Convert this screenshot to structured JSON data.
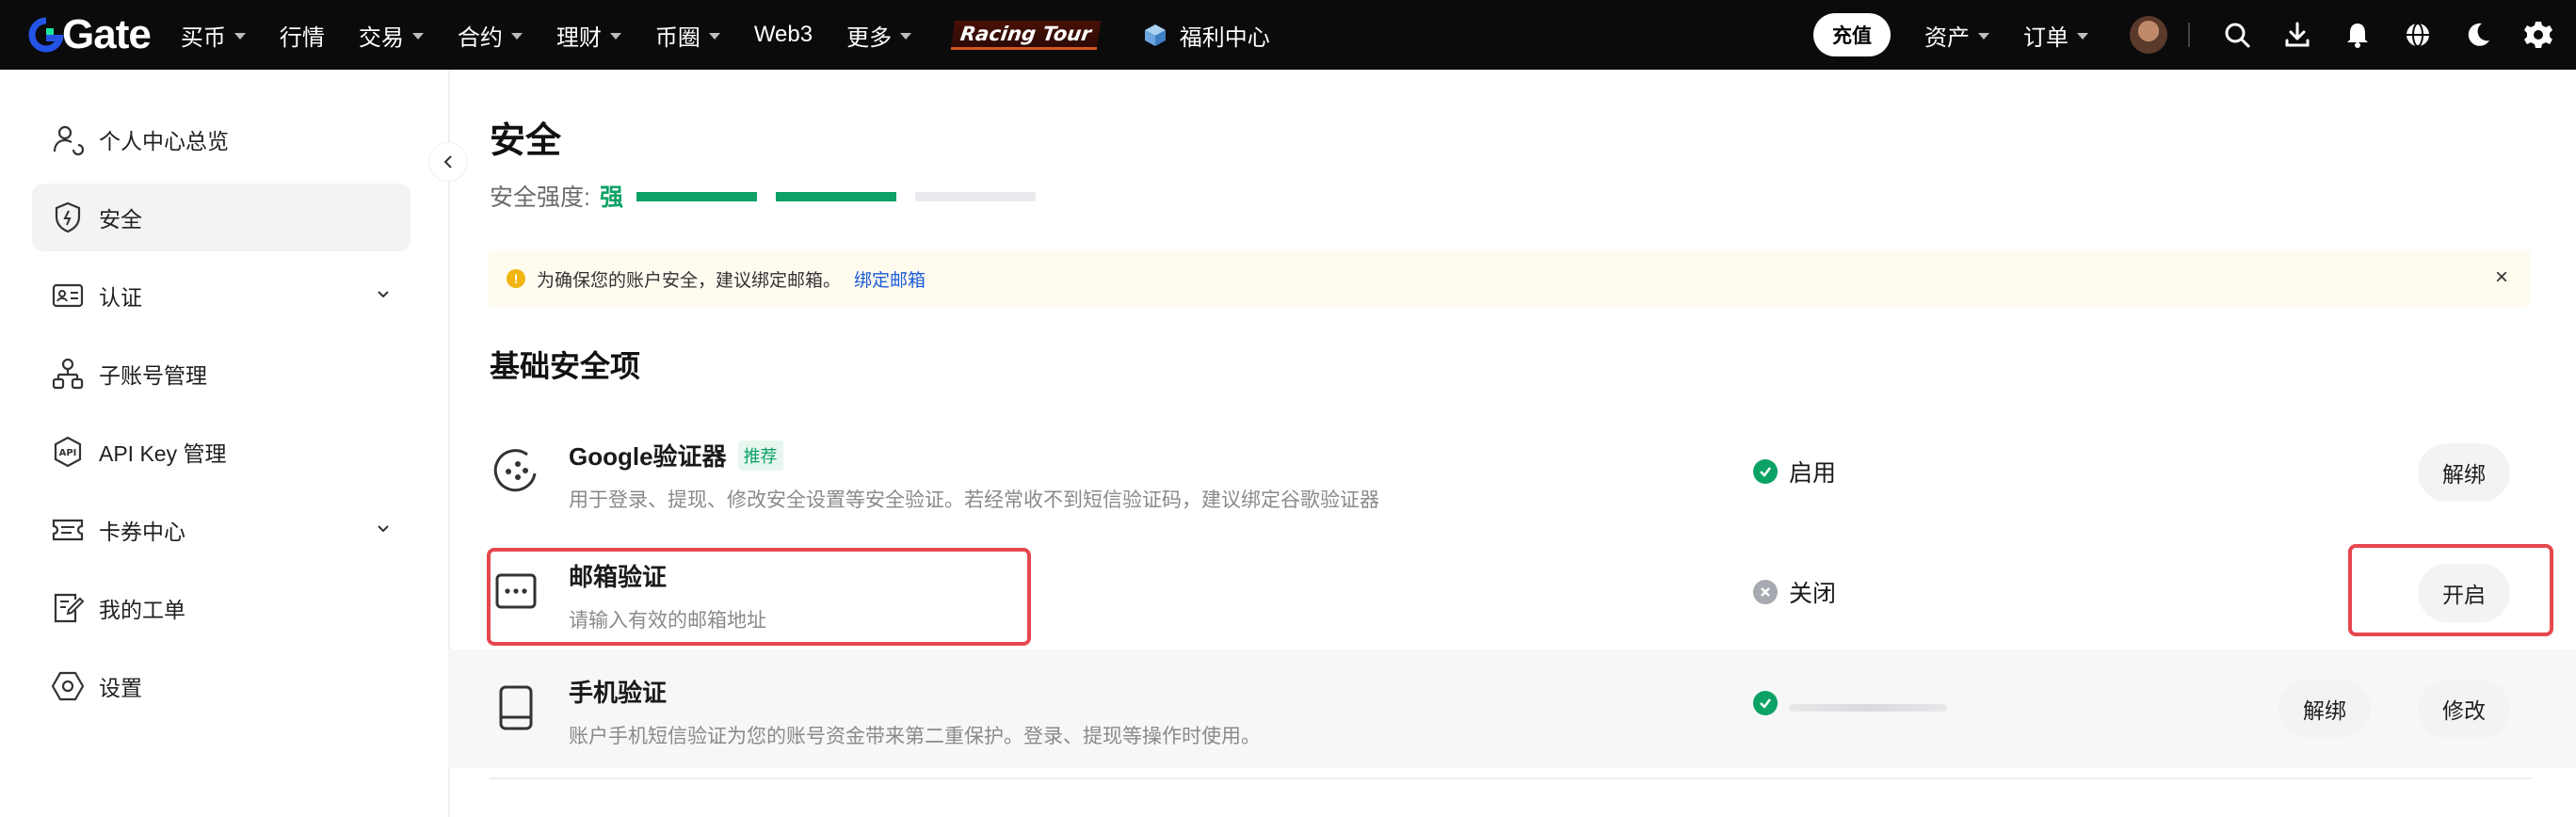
{
  "nav": {
    "logo": "Gate",
    "items": [
      {
        "label": "买币",
        "caret": true
      },
      {
        "label": "行情",
        "caret": false
      },
      {
        "label": "交易",
        "caret": true
      },
      {
        "label": "合约",
        "caret": true
      },
      {
        "label": "理财",
        "caret": true
      },
      {
        "label": "币圈",
        "caret": true
      },
      {
        "label": "Web3",
        "caret": false
      },
      {
        "label": "更多",
        "caret": true
      }
    ],
    "racing": "Racing Tour",
    "gift_label": "福利中心",
    "deposit": "充值",
    "assets": "资产",
    "orders": "订单",
    "icons": [
      "search-icon",
      "download-icon",
      "bell-icon",
      "globe-icon",
      "moon-icon",
      "gear-icon"
    ]
  },
  "sidebar": {
    "items": [
      {
        "label": "个人中心总览",
        "icon": "user-icon",
        "active": false,
        "expand": false
      },
      {
        "label": "安全",
        "icon": "shield-icon",
        "active": true,
        "expand": false
      },
      {
        "label": "认证",
        "icon": "id-card-icon",
        "active": false,
        "expand": true
      },
      {
        "label": "子账号管理",
        "icon": "sub-account-icon",
        "active": false,
        "expand": false
      },
      {
        "label": "API Key 管理",
        "icon": "api-icon",
        "active": false,
        "expand": false
      },
      {
        "label": "卡券中心",
        "icon": "coupon-icon",
        "active": false,
        "expand": true
      },
      {
        "label": "我的工单",
        "icon": "ticket-icon",
        "active": false,
        "expand": false
      },
      {
        "label": "设置",
        "icon": "settings-icon",
        "active": false,
        "expand": false
      }
    ]
  },
  "main": {
    "title": "安全",
    "strength_label": "安全强度:",
    "strength_value": "强",
    "strength_level": 2,
    "strength_max": 3,
    "alert": {
      "text": "为确保您的账户安全，建议绑定邮箱。",
      "link": "绑定邮箱",
      "close": "×"
    },
    "section_title": "基础安全项",
    "rows": [
      {
        "title": "Google验证器",
        "tag": "推荐",
        "desc": "用于登录、提现、修改安全设置等安全验证。若经常收不到短信验证码，建议绑定谷歌验证器",
        "status": "启用",
        "buttons": [
          "解绑"
        ]
      },
      {
        "title": "邮箱验证",
        "desc": "请输入有效的邮箱地址",
        "status": "关闭",
        "buttons": [
          "开启"
        ]
      },
      {
        "title": "手机验证",
        "desc": "账户手机短信验证为您的账号资金带来第二重保护。登录、提现等操作时使用。",
        "status": "",
        "buttons": [
          "解绑",
          "修改"
        ]
      }
    ]
  },
  "colors": {
    "accent_green": "#0ca265",
    "highlight_red": "#e5484d",
    "link_blue": "#1c5bd9",
    "alert_bg": "#fffbef"
  }
}
